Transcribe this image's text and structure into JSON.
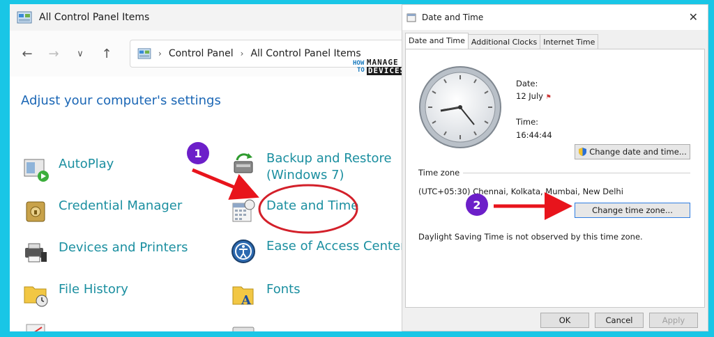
{
  "control_panel": {
    "title": "All Control Panel Items",
    "breadcrumb": [
      "Control Panel",
      "All Control Panel Items"
    ],
    "heading": "Adjust your computer's settings",
    "items": [
      {
        "label": "AutoPlay",
        "icon": "autoplay-icon"
      },
      {
        "label": "Credential Manager",
        "icon": "credential-manager-icon"
      },
      {
        "label": "Devices and Printers",
        "icon": "devices-printers-icon"
      },
      {
        "label": "File History",
        "icon": "file-history-icon"
      },
      {
        "label": "Backup and Restore",
        "label2": "(Windows 7)",
        "icon": "backup-restore-icon"
      },
      {
        "label": "Date and Time",
        "icon": "date-time-icon"
      },
      {
        "label": "Ease of Access Center",
        "icon": "ease-of-access-icon"
      },
      {
        "label": "Fonts",
        "icon": "fonts-icon"
      }
    ]
  },
  "logo": {
    "how": "HOW",
    "to": "TO",
    "manage": "MANAGE",
    "devices": "DEVICES"
  },
  "dialog": {
    "title": "Date and Time",
    "tabs": [
      "Date and Time",
      "Additional Clocks",
      "Internet Time"
    ],
    "active_tab": 0,
    "date_label": "Date:",
    "date_value": "12 July",
    "time_label": "Time:",
    "time_value": "16:44:44",
    "change_date_button": "Change date and time...",
    "timezone_header": "Time zone",
    "timezone_value": "(UTC+05:30) Chennai, Kolkata, Mumbai, New Delhi",
    "change_zone_button": "Change time zone...",
    "dst_note": "Daylight Saving Time is not observed by this time zone.",
    "ok": "OK",
    "cancel": "Cancel",
    "apply": "Apply"
  },
  "annotations": {
    "step1": "1",
    "step2": "2",
    "arrow_color": "#e8141c",
    "highlight_color": "#d3202a",
    "badge_color": "#6c1fc9"
  },
  "colors": {
    "background": "#19c6e6",
    "link": "#1b8fa0",
    "heading": "#1a66b5"
  }
}
